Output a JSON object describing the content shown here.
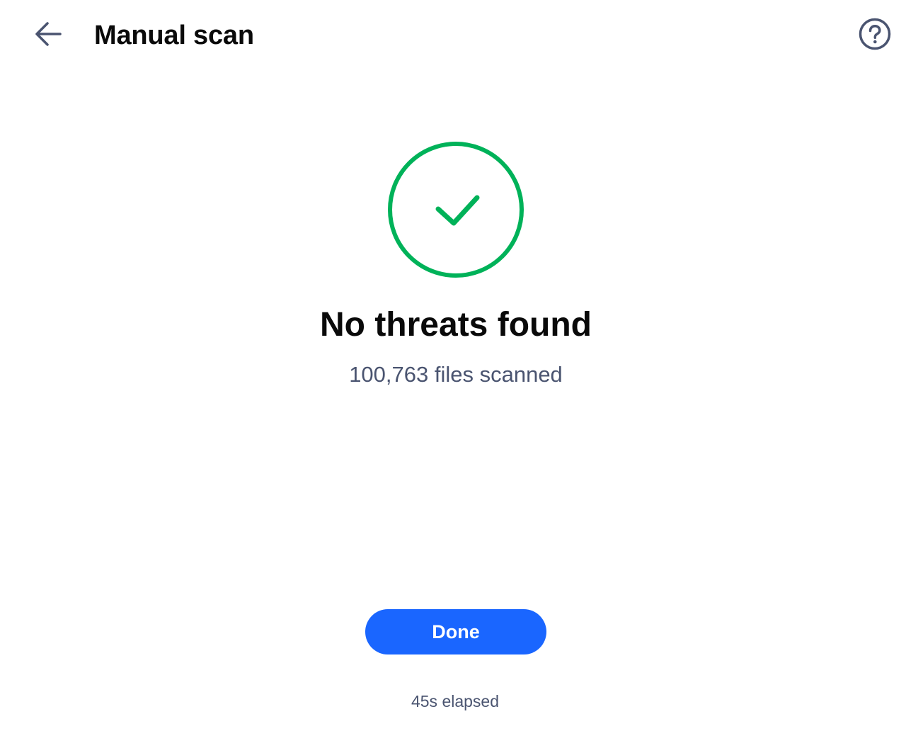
{
  "header": {
    "title": "Manual scan",
    "back_icon": "arrow-left-icon",
    "help_icon": "question-circle-icon"
  },
  "result": {
    "icon": "check-circle-icon",
    "title": "No threats found",
    "files_scanned": "100,763 files scanned"
  },
  "actions": {
    "done_label": "Done"
  },
  "footer": {
    "elapsed": "45s elapsed"
  },
  "colors": {
    "success": "#00b259",
    "primary": "#1a66ff",
    "icon": "#4a5470",
    "muted_text": "#4a5470",
    "title_text": "#0a0a0a"
  }
}
